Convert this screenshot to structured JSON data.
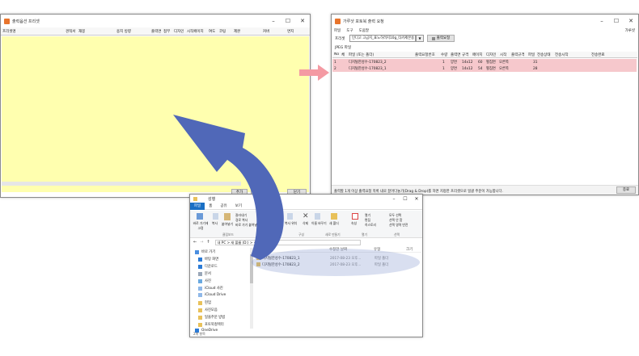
{
  "left_window": {
    "title": "출력옵션 프리셋",
    "columns": [
      "프리셋명",
      "견적서",
      "재봉",
      "용지 방향",
      "출력면",
      "접부",
      "디자인",
      "시작페이지",
      "여도",
      "코팅",
      "제본",
      "커버",
      "면지"
    ],
    "buttons": [
      "추가",
      "수정",
      "닫기"
    ]
  },
  "right_window": {
    "title": "가루샷 포토북 출력 요청",
    "menu": [
      "파일",
      "도구",
      "도움말"
    ],
    "menu_right": "가루샷",
    "preset_label": "프리셋",
    "preset_value": "인디고 고급지_표노하려지10g_타카제본용",
    "request_button": "출력요청",
    "section_label": "JPEG 파일",
    "columns": [
      "No",
      "체",
      "파일 (또는 폴더)",
      "출력요청번호",
      "수량",
      "출력면",
      "규격",
      "페이지",
      "디자인",
      "시작",
      "출력규격",
      "파일",
      "전송상태",
      "전송시작",
      "전송완료"
    ],
    "rows": [
      {
        "no": "1",
        "file": "디지털한성수-170823_2",
        "qty": "1",
        "side": "양면",
        "size": "14x12",
        "pages": "60",
        "design": "펼침면",
        "start": "오른쪽",
        "count": "31"
      },
      {
        "no": "2",
        "file": "디지털한성수-170823_1",
        "qty": "1",
        "side": "양면",
        "size": "14x12",
        "pages": "54",
        "design": "펼침면",
        "start": "오른쪽",
        "count": "28"
      }
    ],
    "status": "출력할 1개 이상 출력요청 목록 내로 끌어다놓기(Drag & Drop)를 하면 지정한 프리셋으로 일괄 주문이 가능합니다.",
    "close_button": "종료"
  },
  "explorer": {
    "title": "성행",
    "ribbon_tabs": [
      "파일",
      "홈",
      "공유",
      "보기"
    ],
    "ribbon_groups": [
      "클립보드",
      "구성",
      "새로 만들기",
      "열기",
      "선택"
    ],
    "ribbon_items": [
      "바로 가기에 고정",
      "복사",
      "붙여넣기",
      "잘라내기",
      "경로 복사",
      "바로 가기 붙여넣기",
      "이동 위치",
      "복사 위치",
      "삭제",
      "이름 바꾸기",
      "새 폴더",
      "속성",
      "열기",
      "편집",
      "히스토리",
      "모두 선택",
      "선택 안 함",
      "선택 영역 반전"
    ],
    "address": "내 PC > 새 볼륨 (D:) > 성행",
    "nav": [
      "바로 가기",
      "바탕 화면",
      "다운로드",
      "문서",
      "사진",
      "iCloud 사진",
      "iCloud Drive",
      "현업",
      "사진모음",
      "일을주문 방법",
      "포토북컬렉터",
      "OneDrive"
    ],
    "list_header": [
      "이름",
      "수정한 날짜",
      "유형",
      "크기"
    ],
    "files": [
      {
        "name": "디지털한성수-170823_1",
        "date": "2017-08-23 오후...",
        "type": "파일 폴더"
      },
      {
        "name": "디지털한성수-170823_2",
        "date": "2017-08-23 오후...",
        "type": "파일 폴더"
      }
    ],
    "status": "2개 항목"
  },
  "colors": {
    "highlight_row": "#f6c8cc",
    "left_pane": "#ffffaf",
    "arrow_blue": "#5068b8",
    "arrow_pink": "#f49aa3"
  }
}
